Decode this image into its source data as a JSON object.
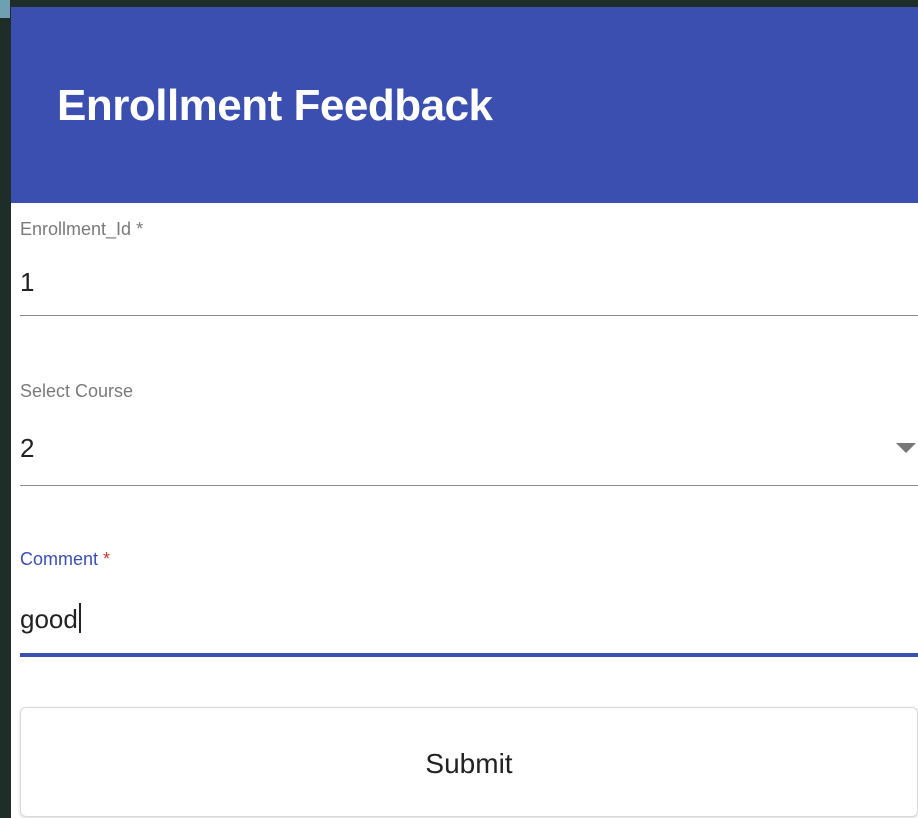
{
  "form": {
    "title": "Enrollment Feedback",
    "enrollment_id": {
      "label": "Enrollment_Id",
      "required_mark": "*",
      "value": "1"
    },
    "course": {
      "label": "Select Course",
      "value": "2",
      "icon": "dropdown-arrow-icon"
    },
    "comment": {
      "label": "Comment",
      "required_mark": "*",
      "value": "good",
      "focused": true
    },
    "submit_label": "Submit"
  },
  "colors": {
    "header_bg": "#3a4fb0",
    "accent": "#3a4fb0",
    "required_focused": "#c0392b",
    "page_bg": "#1f2d28"
  }
}
